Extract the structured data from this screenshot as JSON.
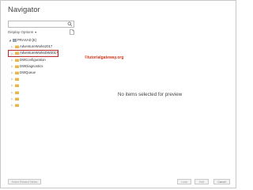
{
  "window": {
    "title": "Navigator"
  },
  "search": {
    "placeholder": ""
  },
  "toolbar": {
    "display_options_label": "Display Options",
    "caret": "▾"
  },
  "tree": {
    "items": [
      {
        "label": "PRASAD [6]",
        "level": 0,
        "chevron": "◢"
      },
      {
        "label": "AdventureWorks2017",
        "level": 1,
        "chevron": "▷"
      },
      {
        "label": "AdventureWorksDW2017",
        "level": 1,
        "chevron": "▷",
        "selected": true
      },
      {
        "label": "DWConfiguration",
        "level": 1,
        "chevron": "▷"
      },
      {
        "label": "DWDiagnostics",
        "level": 1,
        "chevron": "▷"
      },
      {
        "label": "DWQueue",
        "level": 1,
        "chevron": "▷"
      },
      {
        "label": "",
        "level": 1,
        "chevron": "▷"
      },
      {
        "label": "",
        "level": 1,
        "chevron": "▷"
      },
      {
        "label": "",
        "level": 1,
        "chevron": "▷"
      },
      {
        "label": "",
        "level": 1,
        "chevron": "▷"
      },
      {
        "label": "",
        "level": 1,
        "chevron": "▷"
      }
    ]
  },
  "watermark": {
    "text": "©tutorialgateway.org"
  },
  "preview": {
    "empty_text": "No items selected for preview"
  },
  "footer": {
    "select_related_label": "Select Related Tables",
    "load_label": "Load",
    "edit_label": "Edit",
    "cancel_label": "Cancel"
  },
  "colors": {
    "selection_border": "#b82b2b",
    "folder_yellow": "#e8b64a",
    "watermark_red": "#cc3b1e"
  }
}
